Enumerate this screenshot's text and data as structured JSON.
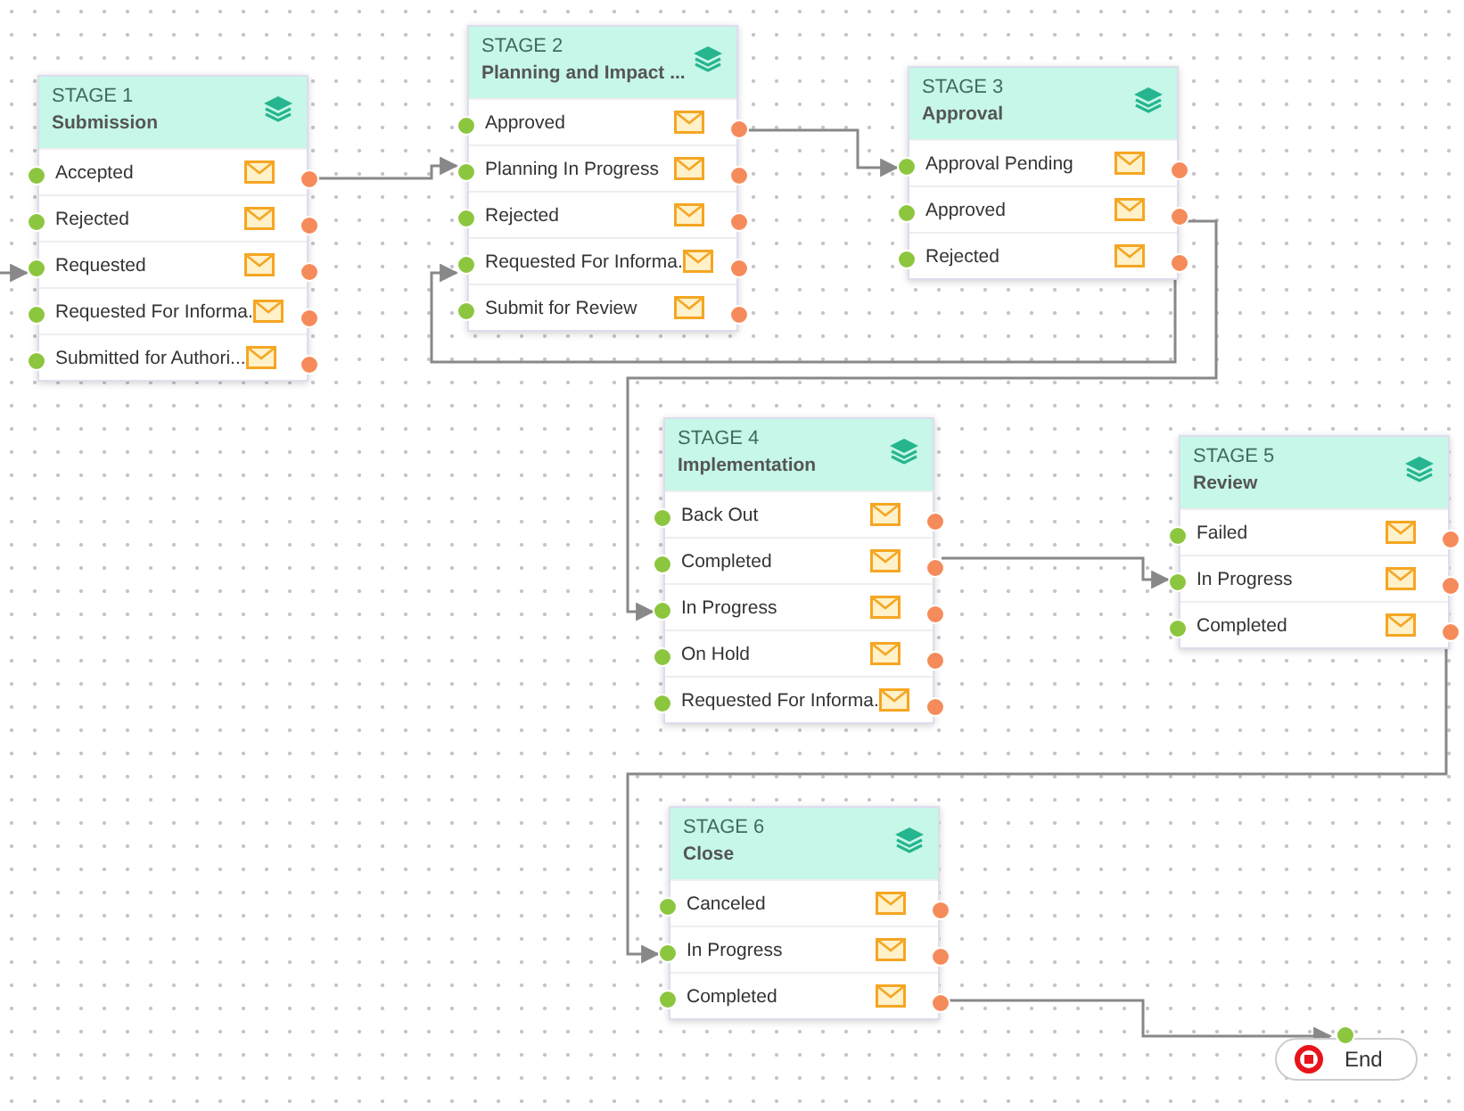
{
  "stages": [
    {
      "label": "STAGE 1",
      "name": "Submission",
      "statuses": [
        {
          "label": "Accepted"
        },
        {
          "label": "Rejected"
        },
        {
          "label": "Requested"
        },
        {
          "label": "Requested For Informa."
        },
        {
          "label": "Submitted for Authori..."
        }
      ]
    },
    {
      "label": "STAGE 2",
      "name": "Planning and Impact ...",
      "statuses": [
        {
          "label": "Approved"
        },
        {
          "label": "Planning In Progress"
        },
        {
          "label": "Rejected"
        },
        {
          "label": "Requested For Informa."
        },
        {
          "label": "Submit for Review"
        }
      ]
    },
    {
      "label": "STAGE 3",
      "name": "Approval",
      "statuses": [
        {
          "label": "Approval Pending"
        },
        {
          "label": "Approved"
        },
        {
          "label": "Rejected"
        }
      ]
    },
    {
      "label": "STAGE 4",
      "name": "Implementation",
      "statuses": [
        {
          "label": "Back Out"
        },
        {
          "label": "Completed"
        },
        {
          "label": "In Progress"
        },
        {
          "label": "On Hold"
        },
        {
          "label": "Requested For Informa."
        }
      ]
    },
    {
      "label": "STAGE 5",
      "name": "Review",
      "statuses": [
        {
          "label": "Failed"
        },
        {
          "label": "In Progress"
        },
        {
          "label": "Completed"
        }
      ]
    },
    {
      "label": "STAGE 6",
      "name": "Close",
      "statuses": [
        {
          "label": "Canceled"
        },
        {
          "label": "In Progress"
        },
        {
          "label": "Completed"
        }
      ]
    }
  ],
  "end_node": {
    "label": "End"
  }
}
